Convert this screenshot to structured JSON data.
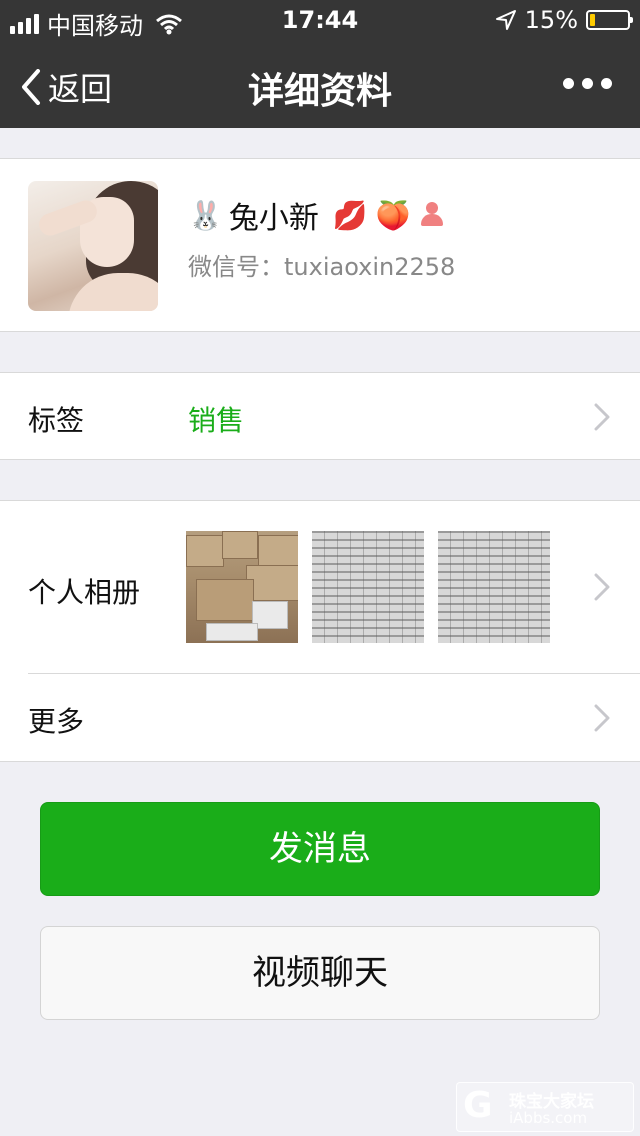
{
  "status_bar": {
    "carrier": "中国移动",
    "time": "17:44",
    "battery_text": "15%",
    "battery_level": 0.15
  },
  "nav": {
    "back_label": "返回",
    "title": "详细资料"
  },
  "profile": {
    "name_prefix_emoji": "🐰",
    "name": "兔小新",
    "name_suffix_emojis": [
      "💋",
      "🍑"
    ],
    "wechat_id_label": "微信号：",
    "wechat_id": "tuxiaoxin2258"
  },
  "tag_row": {
    "label": "标签",
    "value": "销售"
  },
  "album_row": {
    "label": "个人相册"
  },
  "more_row": {
    "label": "更多"
  },
  "buttons": {
    "send_message": "发消息",
    "video_chat": "视频聊天"
  },
  "watermark": {
    "logo_letter": "G",
    "line1": "珠宝大家坛",
    "line2": "iAbbs.com"
  },
  "colors": {
    "nav_bg": "#363636",
    "accent_green": "#1aad19",
    "page_bg": "#efeff4"
  }
}
